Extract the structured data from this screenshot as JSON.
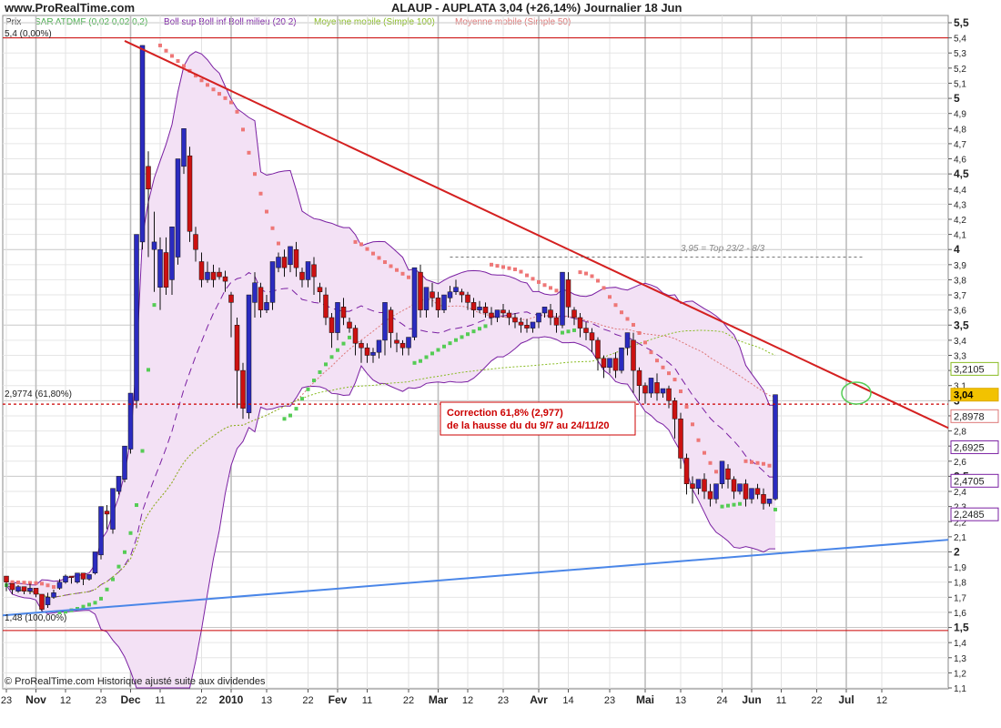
{
  "header": {
    "site": "www.ProRealTime.com",
    "title": "ALAUP - AUPLATA 3,04 (+26,14%) Journalier 18 Jun"
  },
  "legend": {
    "prix": "Prix",
    "sar": "SAR ATDMF (0,02 0,02 0,2)",
    "boll": "Boll sup Boll inf Boll milieu (20 2)",
    "mm100": "Moyenne mobile (Simple 100)",
    "mm50": "Moyenne mobile (Simple 50)"
  },
  "footer": "© ProRealTime.com Historique ajusté suite aux dividendes",
  "colors": {
    "up": "#2b2bc0",
    "down": "#cc1111",
    "trend_down": "#d42020",
    "trend_up": "#4a86e8",
    "sar_up": "#55cc55",
    "sar_down": "#ee7777",
    "boll": "#7a1fa2",
    "boll_fill": "#f3e1f5",
    "mm100": "#88bb22",
    "mm50": "#dd7777",
    "fib": "#cc0000"
  },
  "chart_data": {
    "type": "candlestick",
    "title": "ALAUP - AUPLATA 3,04 (+26,14%) Journalier 18 Jun",
    "ylim": [
      1.1,
      5.5
    ],
    "y_ticks": [
      "1,1",
      "1,2",
      "1,3",
      "1,4",
      "1,5",
      "1,6",
      "1,7",
      "1,8",
      "1,9",
      "2",
      "2,1",
      "2,2",
      "2,3",
      "2,4",
      "2,5",
      "2,6",
      "2,7",
      "2,8",
      "2,9",
      "3",
      "3,1",
      "3,2",
      "3,3",
      "3,4",
      "3,5",
      "3,6",
      "3,7",
      "3,8",
      "3,9",
      "4",
      "4,1",
      "4,2",
      "4,3",
      "4,4",
      "4,5",
      "4,6",
      "4,7",
      "4,8",
      "4,9",
      "5",
      "5,1",
      "5,2",
      "5,3",
      "5,4",
      "5,5"
    ],
    "y_ticks_bold": [
      "1,5",
      "2",
      "2,5",
      "3",
      "3,5",
      "4",
      "4,5",
      "5",
      "5,5"
    ],
    "x_ticks": [
      {
        "t": 0,
        "label": "23"
      },
      {
        "t": 5,
        "label": "Nov"
      },
      {
        "t": 10,
        "label": "12"
      },
      {
        "t": 16,
        "label": "23"
      },
      {
        "t": 21,
        "label": "Dec"
      },
      {
        "t": 26,
        "label": "11"
      },
      {
        "t": 33,
        "label": "22"
      },
      {
        "t": 38,
        "label": "2010"
      },
      {
        "t": 44,
        "label": "13"
      },
      {
        "t": 51,
        "label": "22"
      },
      {
        "t": 56,
        "label": "Fev"
      },
      {
        "t": 61,
        "label": "11"
      },
      {
        "t": 68,
        "label": "22"
      },
      {
        "t": 73,
        "label": "Mar"
      },
      {
        "t": 78,
        "label": "12"
      },
      {
        "t": 84,
        "label": "23"
      },
      {
        "t": 90,
        "label": "Avr"
      },
      {
        "t": 95,
        "label": "14"
      },
      {
        "t": 102,
        "label": "23"
      },
      {
        "t": 108,
        "label": "Mai"
      },
      {
        "t": 114,
        "label": "13"
      },
      {
        "t": 121,
        "label": "24"
      },
      {
        "t": 126,
        "label": "Jun"
      },
      {
        "t": 131,
        "label": "11"
      },
      {
        "t": 137,
        "label": "22"
      },
      {
        "t": 142,
        "label": "Jul"
      },
      {
        "t": 148,
        "label": "12"
      }
    ],
    "x_ticks_bold": [
      "Nov",
      "Dec",
      "2010",
      "Fev",
      "Mar",
      "Avr",
      "Mai",
      "Jun",
      "Jul"
    ],
    "candles": [
      [
        1.84,
        1.8,
        1.78,
        1.74
      ],
      [
        1.79,
        1.75,
        1.74,
        1.72
      ],
      [
        1.74,
        1.77,
        1.73,
        1.78
      ],
      [
        1.77,
        1.74,
        1.72,
        1.73
      ],
      [
        1.74,
        1.76,
        1.72,
        1.79
      ],
      [
        1.76,
        1.72,
        1.7,
        1.74
      ],
      [
        1.72,
        1.62,
        1.6,
        1.7
      ],
      [
        1.65,
        1.7,
        1.63,
        1.73
      ],
      [
        1.7,
        1.73,
        1.69,
        1.75
      ],
      [
        1.76,
        1.8,
        1.75,
        1.82
      ],
      [
        1.8,
        1.84,
        1.79,
        1.85
      ],
      [
        1.84,
        1.83,
        1.8,
        1.79
      ],
      [
        1.8,
        1.86,
        1.79,
        1.8
      ],
      [
        1.86,
        1.82,
        1.8,
        1.78
      ],
      [
        1.82,
        1.85,
        1.82,
        1.81
      ],
      [
        1.86,
        2.0,
        1.97,
        1.85
      ],
      [
        1.98,
        2.3,
        2.28,
        1.95
      ],
      [
        2.27,
        2.25,
        2.15,
        2.31
      ],
      [
        2.15,
        2.42,
        2.4,
        2.12
      ],
      [
        2.4,
        2.5,
        2.48,
        2.38
      ],
      [
        2.48,
        2.7,
        2.68,
        2.46
      ],
      [
        2.68,
        3.05,
        3.0,
        2.65
      ],
      [
        3.0,
        4.1,
        4.05,
        2.95
      ],
      [
        4.05,
        5.35,
        5.3,
        4.0
      ],
      [
        4.55,
        4.4,
        3.95,
        4.65
      ],
      [
        4.0,
        4.05,
        3.72,
        4.25
      ],
      [
        3.75,
        4.0,
        3.6,
        4.08
      ],
      [
        3.98,
        3.75,
        3.7,
        4.08
      ],
      [
        3.8,
        4.15,
        3.95,
        3.7
      ],
      [
        3.95,
        4.6,
        4.55,
        3.9
      ],
      [
        4.55,
        4.8,
        4.5,
        4.7
      ],
      [
        4.62,
        4.12,
        4.05,
        4.68
      ],
      [
        4.1,
        4.0,
        3.92,
        4.15
      ],
      [
        3.92,
        3.8,
        3.75,
        3.98
      ],
      [
        3.8,
        3.85,
        3.78,
        3.92
      ],
      [
        3.85,
        3.8,
        3.75,
        3.9
      ],
      [
        3.85,
        3.82,
        3.8,
        3.88
      ],
      [
        3.82,
        3.79,
        3.72,
        3.86
      ],
      [
        3.7,
        3.65,
        3.42,
        3.72
      ],
      [
        3.5,
        3.2,
        2.95,
        3.55
      ],
      [
        3.2,
        2.95,
        2.88,
        3.25
      ],
      [
        2.92,
        3.7,
        3.62,
        2.88
      ],
      [
        3.65,
        3.78,
        3.55,
        3.85
      ],
      [
        3.75,
        3.6,
        3.55,
        3.78
      ],
      [
        3.6,
        3.65,
        3.58,
        3.7
      ],
      [
        3.65,
        3.92,
        3.85,
        3.6
      ],
      [
        3.88,
        3.95,
        3.85,
        3.98
      ],
      [
        3.95,
        3.88,
        3.82,
        4.0
      ],
      [
        3.9,
        4.02,
        3.98,
        3.85
      ],
      [
        4.0,
        3.88,
        3.82,
        4.05
      ],
      [
        3.85,
        3.8,
        3.75,
        3.88
      ],
      [
        3.8,
        3.92,
        3.88,
        3.75
      ],
      [
        3.9,
        3.82,
        3.7,
        3.95
      ],
      [
        3.75,
        3.72,
        3.65,
        3.78
      ],
      [
        3.7,
        3.55,
        3.5,
        3.75
      ],
      [
        3.55,
        3.45,
        3.35,
        3.58
      ],
      [
        3.45,
        3.65,
        3.6,
        3.4
      ],
      [
        3.62,
        3.55,
        3.5,
        3.68
      ],
      [
        3.52,
        3.48,
        3.45,
        3.55
      ],
      [
        3.48,
        3.38,
        3.3,
        3.5
      ],
      [
        3.38,
        3.35,
        3.25,
        3.4
      ],
      [
        3.35,
        3.3,
        3.25,
        3.38
      ],
      [
        3.3,
        3.32,
        3.25,
        3.35
      ],
      [
        3.32,
        3.4,
        3.35,
        3.28
      ],
      [
        3.4,
        3.65,
        3.55,
        3.3
      ],
      [
        3.6,
        3.45,
        3.35,
        3.62
      ],
      [
        3.4,
        3.38,
        3.32,
        3.45
      ],
      [
        3.38,
        3.35,
        3.3,
        3.4
      ],
      [
        3.35,
        3.42,
        3.38,
        3.3
      ],
      [
        3.42,
        3.88,
        3.85,
        3.4
      ],
      [
        3.85,
        3.6,
        3.55,
        3.9
      ],
      [
        3.6,
        3.75,
        3.7,
        3.55
      ],
      [
        3.72,
        3.68,
        3.62,
        3.78
      ],
      [
        3.68,
        3.6,
        3.55,
        3.72
      ],
      [
        3.6,
        3.7,
        3.68,
        3.58
      ],
      [
        3.68,
        3.72,
        3.65,
        3.76
      ],
      [
        3.72,
        3.75,
        3.7,
        3.8
      ],
      [
        3.72,
        3.7,
        3.65,
        3.74
      ],
      [
        3.7,
        3.65,
        3.6,
        3.72
      ],
      [
        3.65,
        3.6,
        3.55,
        3.68
      ],
      [
        3.6,
        3.62,
        3.58,
        3.66
      ],
      [
        3.62,
        3.58,
        3.55,
        3.65
      ],
      [
        3.58,
        3.55,
        3.5,
        3.62
      ],
      [
        3.55,
        3.6,
        3.58,
        3.52
      ],
      [
        3.6,
        3.58,
        3.55,
        3.64
      ],
      [
        3.58,
        3.55,
        3.5,
        3.6
      ],
      [
        3.55,
        3.52,
        3.48,
        3.58
      ],
      [
        3.52,
        3.5,
        3.45,
        3.55
      ],
      [
        3.5,
        3.48,
        3.45,
        3.54
      ],
      [
        3.48,
        3.52,
        3.5,
        3.45
      ],
      [
        3.52,
        3.58,
        3.55,
        3.48
      ],
      [
        3.58,
        3.62,
        3.6,
        3.55
      ],
      [
        3.6,
        3.55,
        3.5,
        3.64
      ],
      [
        3.55,
        3.5,
        3.45,
        3.58
      ],
      [
        3.5,
        3.85,
        3.8,
        3.48
      ],
      [
        3.8,
        3.62,
        3.55,
        3.85
      ],
      [
        3.6,
        3.55,
        3.5,
        3.62
      ],
      [
        3.55,
        3.48,
        3.42,
        3.58
      ],
      [
        3.48,
        3.45,
        3.4,
        3.52
      ],
      [
        3.45,
        3.4,
        3.32,
        3.48
      ],
      [
        3.4,
        3.28,
        3.2,
        3.42
      ],
      [
        3.28,
        3.22,
        3.15,
        3.3
      ],
      [
        3.22,
        3.28,
        3.25,
        3.18
      ],
      [
        3.28,
        3.2,
        3.15,
        3.32
      ],
      [
        3.2,
        3.35,
        3.3,
        3.18
      ],
      [
        3.35,
        3.45,
        3.4,
        3.3
      ],
      [
        3.4,
        3.2,
        3.05,
        3.45
      ],
      [
        3.2,
        3.1,
        3.0,
        3.22
      ],
      [
        3.1,
        3.05,
        2.98,
        3.12
      ],
      [
        3.05,
        3.15,
        3.1,
        3.02
      ],
      [
        3.12,
        3.05,
        3.0,
        3.18
      ],
      [
        3.05,
        3.08,
        3.05,
        3.02
      ],
      [
        3.08,
        3.0,
        2.95,
        3.1
      ],
      [
        3.0,
        2.88,
        2.75,
        3.02
      ],
      [
        2.88,
        2.62,
        2.55,
        2.92
      ],
      [
        2.62,
        2.45,
        2.38,
        2.65
      ],
      [
        2.45,
        2.42,
        2.32,
        2.5
      ],
      [
        2.42,
        2.48,
        2.45,
        2.38
      ],
      [
        2.48,
        2.4,
        2.35,
        2.52
      ],
      [
        2.4,
        2.35,
        2.3,
        2.45
      ],
      [
        2.35,
        2.45,
        2.42,
        2.32
      ],
      [
        2.45,
        2.6,
        2.55,
        2.42
      ],
      [
        2.55,
        2.48,
        2.42,
        2.58
      ],
      [
        2.48,
        2.4,
        2.35,
        2.5
      ],
      [
        2.4,
        2.45,
        2.42,
        2.38
      ],
      [
        2.45,
        2.35,
        2.3,
        2.48
      ],
      [
        2.35,
        2.42,
        2.4,
        2.32
      ],
      [
        2.42,
        2.38,
        2.35,
        2.45
      ],
      [
        2.38,
        2.32,
        2.28,
        2.42
      ],
      [
        2.32,
        2.35,
        2.32,
        2.3
      ],
      [
        2.35,
        3.04,
        3.0,
        2.34
      ]
    ],
    "annotations": {
      "fib_upper_label": "5,4 (0,00%)",
      "fib_mid_label": "2,9774 (61,80%)",
      "fib_lower_label": "1,48 (100,00%)",
      "top_line_label": "3,95 = Top 23/2 - 8/3",
      "correction_line1": "Correction 61,8% (2,977)",
      "correction_line2": "de la hausse du du 9/7 au 24/11/20"
    },
    "right_badges": [
      {
        "label": "3,2105",
        "value": 3.2105,
        "color": "#88bb22"
      },
      {
        "label": "3,04",
        "value": 3.04,
        "color": "#ddaa00",
        "filled": true
      },
      {
        "label": "2,8978",
        "value": 2.8978,
        "color": "#dd7777"
      },
      {
        "label": "2,6925",
        "value": 2.6925,
        "color": "#7a1fa2"
      },
      {
        "label": "2,4705",
        "value": 2.4705,
        "color": "#7a1fa2"
      },
      {
        "label": "2,2485",
        "value": 2.2485,
        "color": "#7a1fa2"
      }
    ]
  }
}
